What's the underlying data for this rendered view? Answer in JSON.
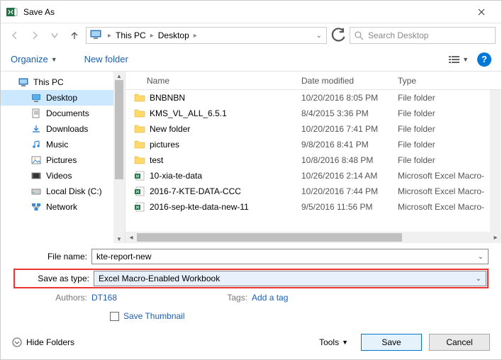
{
  "title": "Save As",
  "breadcrumb": {
    "root": "This PC",
    "folder": "Desktop"
  },
  "search_placeholder": "Search Desktop",
  "toolbar": {
    "organize": "Organize",
    "new_folder": "New folder"
  },
  "sidebar": {
    "items": [
      {
        "label": "This PC",
        "kind": "pc"
      },
      {
        "label": "Desktop",
        "kind": "desktop",
        "selected": true
      },
      {
        "label": "Documents",
        "kind": "docs"
      },
      {
        "label": "Downloads",
        "kind": "downloads"
      },
      {
        "label": "Music",
        "kind": "music"
      },
      {
        "label": "Pictures",
        "kind": "pictures"
      },
      {
        "label": "Videos",
        "kind": "videos"
      },
      {
        "label": "Local Disk (C:)",
        "kind": "disk"
      },
      {
        "label": "Network",
        "kind": "network"
      }
    ]
  },
  "columns": {
    "name": "Name",
    "date": "Date modified",
    "type": "Type"
  },
  "files": [
    {
      "name": "BNBNBN",
      "date": "10/20/2016 8:05 PM",
      "type": "File folder",
      "icon": "folder"
    },
    {
      "name": "KMS_VL_ALL_6.5.1",
      "date": "8/4/2015 3:36 PM",
      "type": "File folder",
      "icon": "folder"
    },
    {
      "name": "New folder",
      "date": "10/20/2016 7:41 PM",
      "type": "File folder",
      "icon": "folder"
    },
    {
      "name": "pictures",
      "date": "9/8/2016 8:41 PM",
      "type": "File folder",
      "icon": "folder"
    },
    {
      "name": "test",
      "date": "10/8/2016 8:48 PM",
      "type": "File folder",
      "icon": "folder"
    },
    {
      "name": "10-xia-te-data",
      "date": "10/26/2016 2:14 AM",
      "type": "Microsoft Excel Macro-",
      "icon": "excel"
    },
    {
      "name": "2016-7-KTE-DATA-CCC",
      "date": "10/20/2016 7:44 PM",
      "type": "Microsoft Excel Macro-",
      "icon": "excel"
    },
    {
      "name": "2016-sep-kte-data-new-11",
      "date": "9/5/2016 11:56 PM",
      "type": "Microsoft Excel Macro-",
      "icon": "excel"
    }
  ],
  "file_name_label": "File name:",
  "file_name_value": "kte-report-new",
  "save_type_label": "Save as type:",
  "save_type_value": "Excel Macro-Enabled Workbook",
  "authors_label": "Authors:",
  "authors_value": "DT168",
  "tags_label": "Tags:",
  "tags_value": "Add a tag",
  "save_thumbnail": "Save Thumbnail",
  "hide_folders": "Hide Folders",
  "tools": "Tools",
  "save": "Save",
  "cancel": "Cancel"
}
